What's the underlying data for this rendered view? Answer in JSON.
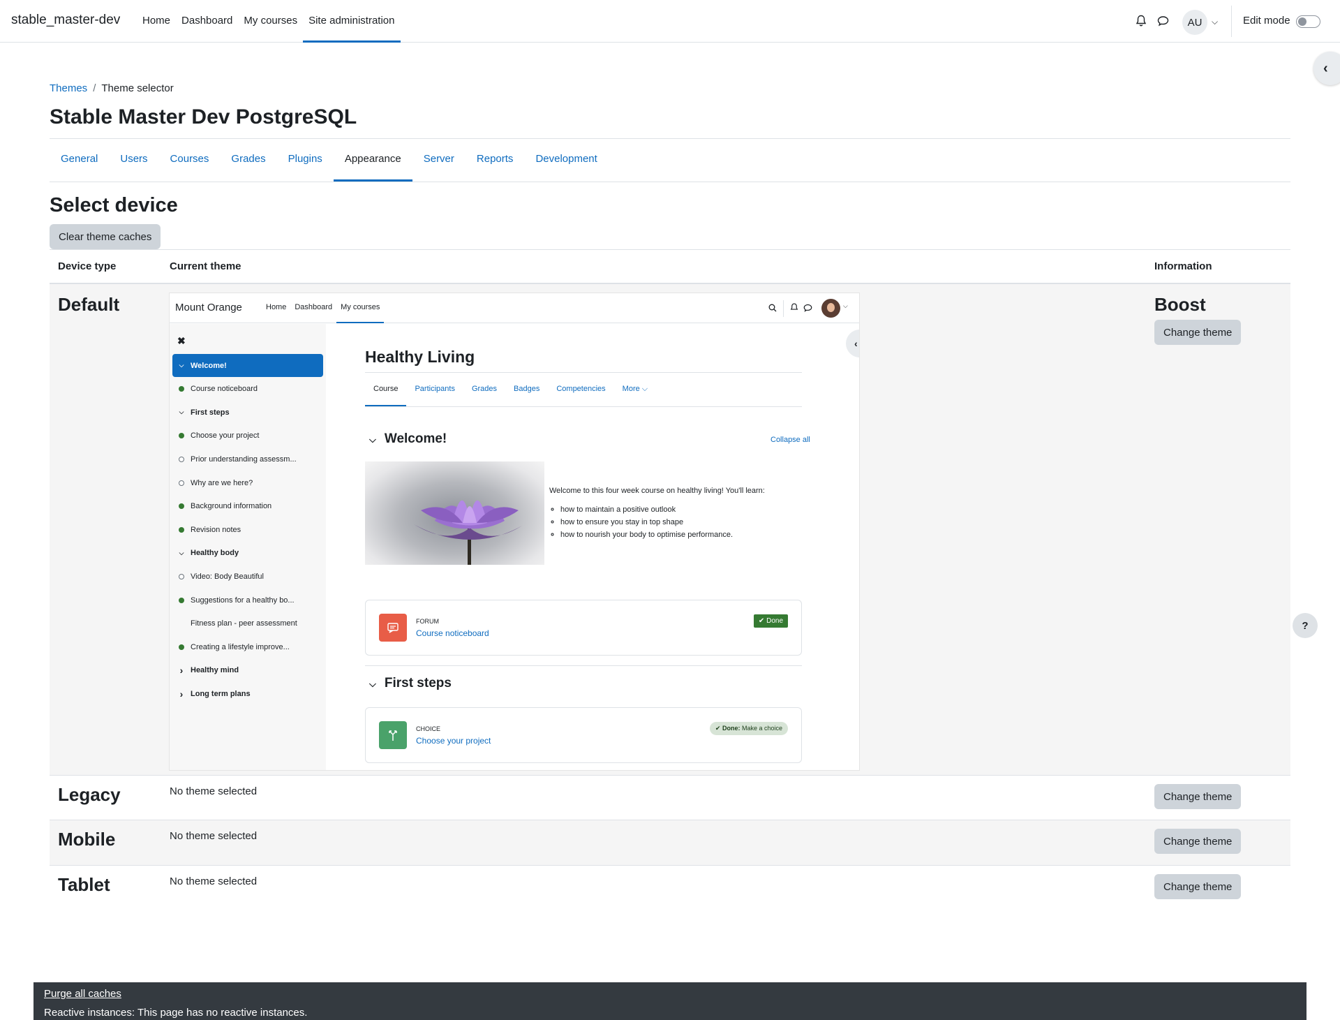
{
  "navbar": {
    "brand": "stable_master-dev",
    "links": [
      "Home",
      "Dashboard",
      "My courses",
      "Site administration"
    ],
    "active_link": "Site administration",
    "avatar_initials": "AU",
    "edit_mode_label": "Edit mode",
    "edit_mode_on": false
  },
  "breadcrumb": {
    "parent": "Themes",
    "current": "Theme selector"
  },
  "page_title": "Stable Master Dev PostgreSQL",
  "admin_tabs": [
    "General",
    "Users",
    "Courses",
    "Grades",
    "Plugins",
    "Appearance",
    "Server",
    "Reports",
    "Development"
  ],
  "active_tab": "Appearance",
  "section_title": "Select device",
  "clear_caches_label": "Clear theme caches",
  "table": {
    "headers": {
      "device": "Device type",
      "theme": "Current theme",
      "info": "Information"
    },
    "rows": [
      {
        "device": "Default",
        "theme_name": "Boost",
        "change_label": "Change theme"
      },
      {
        "device": "Legacy",
        "theme_text": "No theme selected",
        "change_label": "Change theme"
      },
      {
        "device": "Mobile",
        "theme_text": "No theme selected",
        "change_label": "Change theme"
      },
      {
        "device": "Tablet",
        "theme_text": "No theme selected",
        "change_label": "Change theme"
      }
    ]
  },
  "preview": {
    "brand": "Mount Orange",
    "links": [
      "Home",
      "Dashboard",
      "My courses"
    ],
    "drawer": [
      {
        "label": "Welcome!",
        "marker": "chevron-down",
        "active": true
      },
      {
        "label": "Course noticeboard",
        "marker": "dot"
      },
      {
        "label": "First steps",
        "marker": "chevron-down",
        "bold": true
      },
      {
        "label": "Choose your project",
        "marker": "dot"
      },
      {
        "label": "Prior understanding assessm...",
        "marker": "circle"
      },
      {
        "label": "Why are we here?",
        "marker": "circle"
      },
      {
        "label": "Background information",
        "marker": "dot"
      },
      {
        "label": "Revision notes",
        "marker": "dot"
      },
      {
        "label": "Healthy body",
        "marker": "chevron-down",
        "bold": true
      },
      {
        "label": "Video: Body Beautiful",
        "marker": "circle"
      },
      {
        "label": "Suggestions for a healthy bo...",
        "marker": "dot"
      },
      {
        "label": "Fitness plan - peer assessment",
        "marker": "none"
      },
      {
        "label": "Creating a lifestyle improve...",
        "marker": "dot"
      },
      {
        "label": "Healthy mind",
        "marker": "chevron-right",
        "bold": true
      },
      {
        "label": "Long term plans",
        "marker": "chevron-right",
        "bold": true
      }
    ],
    "course_title": "Healthy Living",
    "course_tabs": [
      "Course",
      "Participants",
      "Grades",
      "Badges",
      "Competencies",
      "More"
    ],
    "welcome_title": "Welcome!",
    "collapse_all": "Collapse all",
    "intro": "Welcome to this four week course on healthy living! You'll learn:",
    "bullets": [
      "how to maintain a positive outlook",
      "how to ensure you stay in top shape",
      "how to nourish your body to optimise performance."
    ],
    "forum": {
      "kind": "FORUM",
      "name": "Course noticeboard",
      "badge": "Done"
    },
    "first_steps_title": "First steps",
    "choice": {
      "kind": "CHOICE",
      "name": "Choose your project",
      "badge_bold": "Done:",
      "badge_text": "Make a choice"
    }
  },
  "footer": {
    "purge": "Purge all caches",
    "reactive": "Reactive instances: This page has no reactive instances."
  },
  "colors": {
    "primary": "#0f6cbf",
    "success": "#357a32",
    "footer_bg": "#343a40"
  }
}
